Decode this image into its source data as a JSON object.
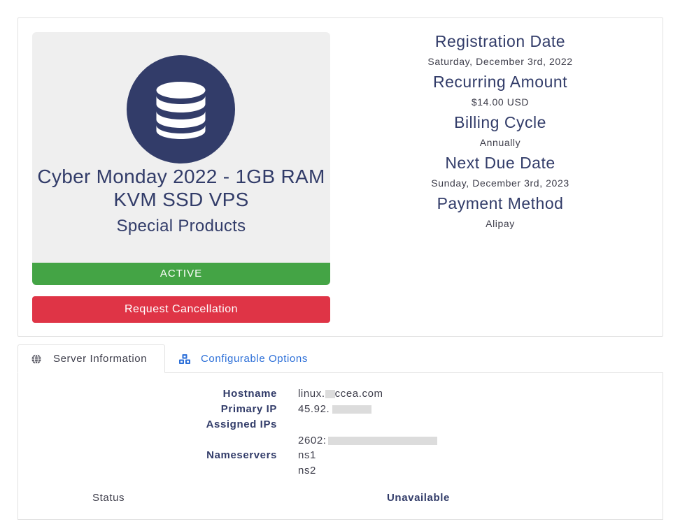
{
  "product": {
    "name": "Cyber Monday 2022 - 1GB RAM KVM SSD VPS",
    "group": "Special Products",
    "status": "ACTIVE",
    "cancel_label": "Request Cancellation",
    "icon": "database-icon"
  },
  "billing": [
    {
      "label": "Registration Date",
      "value": "Saturday, December 3rd, 2022"
    },
    {
      "label": "Recurring Amount",
      "value": "$14.00 USD"
    },
    {
      "label": "Billing Cycle",
      "value": "Annually"
    },
    {
      "label": "Next Due Date",
      "value": "Sunday, December 3rd, 2023"
    },
    {
      "label": "Payment Method",
      "value": "Alipay"
    }
  ],
  "tabs": [
    {
      "label": "Server Information",
      "icon": "globe-icon",
      "active": true
    },
    {
      "label": "Configurable Options",
      "icon": "cubes-icon",
      "active": false
    }
  ],
  "server": {
    "hostname_label": "Hostname",
    "hostname_prefix": "linux.",
    "hostname_suffix": "ccea.com",
    "primary_ip_label": "Primary IP",
    "primary_ip_prefix": "45.92.",
    "assigned_ips_label": "Assigned IPs",
    "assigned_ip_prefix": "2602:",
    "nameservers_label": "Nameservers",
    "ns1": "ns1",
    "ns2": "ns2",
    "status_label": "Status",
    "status_value": "Unavailable"
  },
  "colors": {
    "primary": "#323c69",
    "active": "#44a445",
    "danger": "#df3446",
    "link": "#2c6fd8"
  }
}
